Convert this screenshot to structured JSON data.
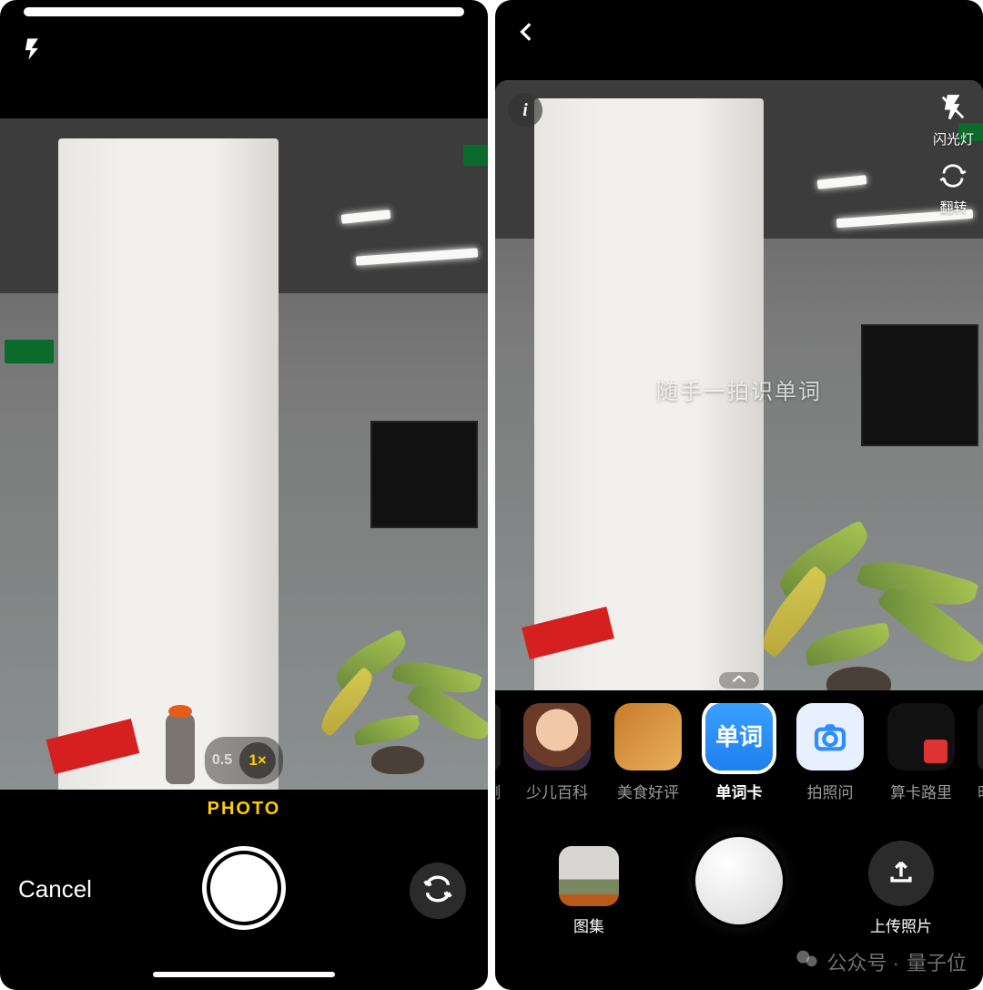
{
  "left": {
    "mode_label": "PHOTO",
    "cancel_label": "Cancel",
    "zoom": {
      "wide": "0.5",
      "active": "1×"
    }
  },
  "right": {
    "viewfinder_hint": "随手一拍识单词",
    "flash_label": "闪光灯",
    "flip_label": "翻转",
    "modes": {
      "item0": "检测",
      "item1": "少儿百科",
      "item2": "美食好评",
      "item3": "单词卡",
      "item3_icon_text": "单词",
      "item4": "拍照问",
      "item5": "算卡路里",
      "item6": "时分"
    },
    "gallery_label": "图集",
    "upload_label": "上传照片"
  },
  "watermark": {
    "prefix": "公众号 · ",
    "name": "量子位"
  }
}
